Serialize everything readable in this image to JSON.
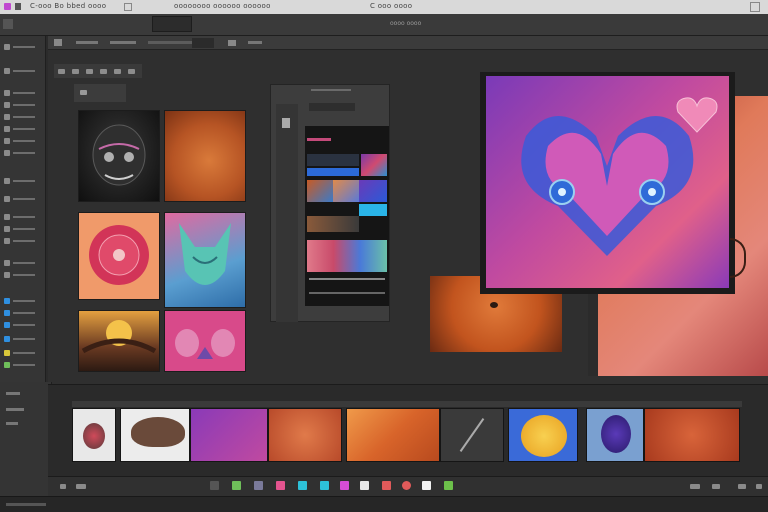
{
  "window": {
    "title_left": "C-ooo Bo bbed oooo",
    "title_center": "oooooooo oooooo oooooo",
    "title_right": "C ooo oooo"
  },
  "toolbar": {
    "title": "oooo oooo"
  },
  "icons": {
    "app": "app-icon",
    "menu": "menu-icon",
    "heart": "heart-icon"
  },
  "colors": {
    "accent_blue": "#2f8fe0",
    "bottom_icons": [
      "#6fbf5a",
      "#7a7a9a",
      "#e4548f",
      "#2dc1d8",
      "#d64dd6",
      "#e8e8e8",
      "#e05a5a",
      "#e05a5a",
      "#f2f2f2",
      "#6cc04a"
    ]
  }
}
